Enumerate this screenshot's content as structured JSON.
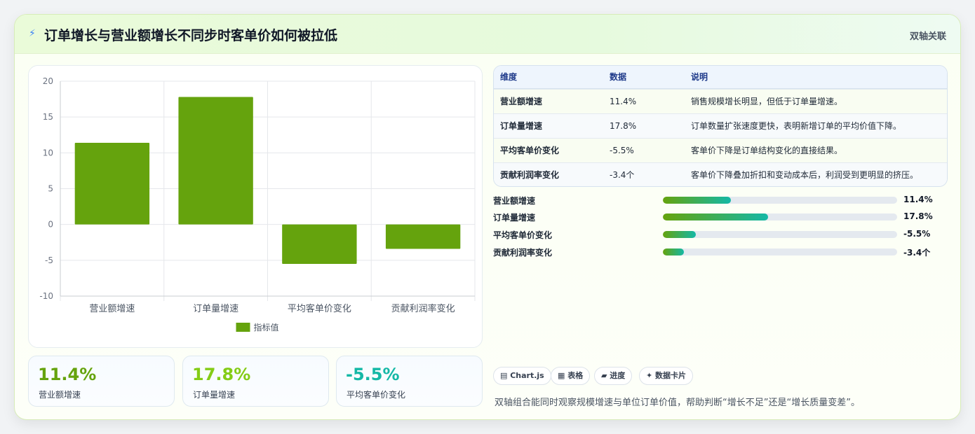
{
  "header": {
    "icon": "lightning-icon",
    "title": "订单增长与营业额增长不同步时客单价如何被拉低",
    "badge": "双轴关联"
  },
  "chart_data": {
    "type": "bar",
    "categories": [
      "营业额增速",
      "订单量增速",
      "平均客单价变化",
      "贡献利润率变化"
    ],
    "series": [
      {
        "name": "指标值",
        "values": [
          11.4,
          17.8,
          -5.5,
          -3.4
        ],
        "color": "#65a30d"
      }
    ],
    "ylim": [
      -10,
      20
    ],
    "yticks": [
      20,
      15,
      10,
      5,
      0,
      -5,
      -10
    ],
    "grid": true,
    "legend": "bottom"
  },
  "stats": [
    {
      "value": "11.4%",
      "label": "营业额增速",
      "color": "#65a30d"
    },
    {
      "value": "17.8%",
      "label": "订单量增速",
      "color": "#84cc16"
    },
    {
      "value": "-5.5%",
      "label": "平均客单价变化",
      "color": "#14b8a6"
    }
  ],
  "table": {
    "headers": [
      "维度",
      "数据",
      "说明"
    ],
    "rows": [
      [
        "营业额增速",
        "11.4%",
        "销售规模增长明显，但低于订单量增速。"
      ],
      [
        "订单量增速",
        "17.8%",
        "订单数量扩张速度更快，表明新增订单的平均价值下降。"
      ],
      [
        "平均客单价变化",
        "-5.5%",
        "客单价下降是订单结构变化的直接结果。"
      ],
      [
        "贡献利润率变化",
        "-3.4个",
        "客单价下降叠加折扣和变动成本后，利润受到更明显的挤压。"
      ]
    ]
  },
  "progress": [
    {
      "label": "营业额增速",
      "value": "11.4%",
      "fraction": 0.29
    },
    {
      "label": "订单量增速",
      "value": "17.8%",
      "fraction": 0.45
    },
    {
      "label": "平均客单价变化",
      "value": "-5.5%",
      "fraction": 0.14
    },
    {
      "label": "贡献利润率变化",
      "value": "-3.4个",
      "fraction": 0.09
    }
  ],
  "tags": [
    "▤ Chart.js",
    "▦ 表格",
    "▰ 进度",
    "✦ 数据卡片"
  ],
  "footnote": "双轴组合能同时观察规模增速与单位订单价值，帮助判断“增长不足”还是“增长质量变差”。"
}
